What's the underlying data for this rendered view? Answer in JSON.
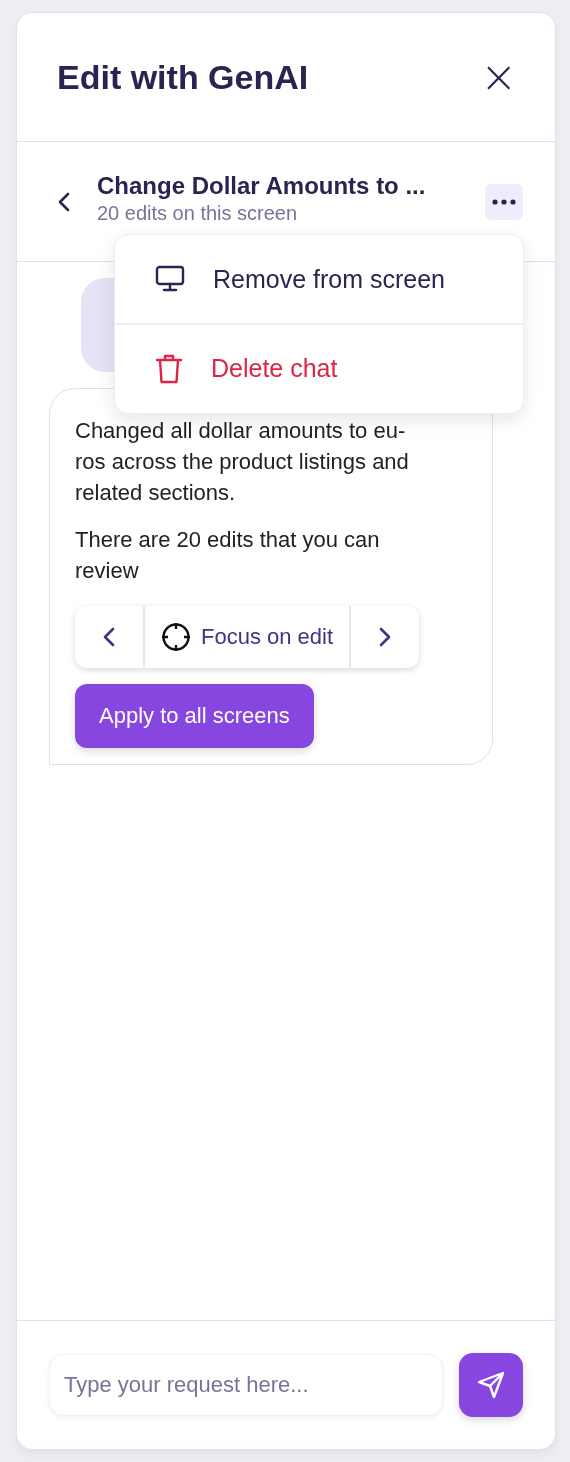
{
  "header": {
    "title": "Edit with GenAI",
    "close_icon": "×"
  },
  "chat": {
    "title": "Change Dollar Amounts to ...",
    "subtitle": "20 edits on this screen"
  },
  "menu": {
    "items": [
      {
        "kind": "normal",
        "label": "Remove from screen"
      },
      {
        "kind": "danger",
        "label": "Delete chat"
      }
    ]
  },
  "messages": [
    {
      "kind": "user"
    },
    {
      "kind": "assistant",
      "paragraphs": [
        [
          "Changed all dollar amounts to eu-",
          "ros across the product listings and",
          "related sections."
        ],
        [
          "There are 20 edits that you can",
          "review"
        ]
      ],
      "focus_label": "Focus on edit",
      "apply_label": "Apply to all screens"
    }
  ],
  "composer": {
    "placeholder": "Type your request here..."
  }
}
